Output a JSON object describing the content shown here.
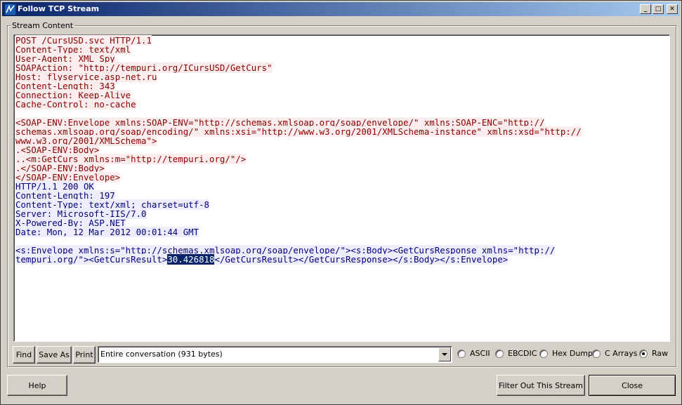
{
  "window": {
    "title": "Follow TCP Stream",
    "minimize_glyph": "_",
    "maximize_glyph": "□",
    "close_glyph": "✕"
  },
  "group_label": "Stream Content",
  "stream": {
    "request_lines": [
      "POST /CursUSD.svc HTTP/1.1",
      "Content-Type: text/xml",
      "User-Agent: XML Spy",
      "SOAPAction: \"http://tempuri.org/ICursUSD/GetCurs\"",
      "Host: flyservice.asp-net.ru",
      "Content-Length: 343",
      "Connection: Keep-Alive",
      "Cache-Control: no-cache",
      "",
      "<SOAP-ENV:Envelope xmlns:SOAP-ENV=\"http://schemas.xmlsoap.org/soap/envelope/\" xmlns:SOAP-ENC=\"http://",
      "schemas.xmlsoap.org/soap/encoding/\" xmlns:xsi=\"http://www.w3.org/2001/XMLSchema-instance\" xmlns:xsd=\"http://",
      "www.w3.org/2001/XMLSchema\">",
      ".<SOAP-ENV:Body>",
      "..<m:GetCurs xmlns:m=\"http://tempuri.org/\"/>",
      ".</SOAP-ENV:Body>",
      "</SOAP-ENV:Envelope>"
    ],
    "response_lines": [
      "HTTP/1.1 200 OK",
      "Content-Length: 197",
      "Content-Type: text/xml; charset=utf-8",
      "Server: Microsoft-IIS/7.0",
      "X-Powered-By: ASP.NET",
      "Date: Mon, 12 Mar 2012 00:01:44 GMT",
      "",
      "<s:Envelope xmlns:s=\"http://schemas.xmlsoap.org/soap/envelope/\"><s:Body><GetCursResponse xmlns=\"http://"
    ],
    "last_line_before": "tempuri.org/\"><GetCursResult>",
    "selected_text": "30.426818",
    "last_line_after": "</GetCursResult></GetCursResponse></s:Body></s:Envelope>",
    "colors": {
      "request_text": "#8b0000",
      "request_bg": "#fbeded",
      "response_text": "#000080",
      "response_bg": "#ededfb",
      "selection_bg": "#0a246a"
    }
  },
  "controls": {
    "find_label": "Find",
    "save_as_label": "Save As",
    "print_label": "Print",
    "conversation_select": "Entire conversation (931 bytes)",
    "radios": [
      {
        "label": "ASCII",
        "selected": false
      },
      {
        "label": "EBCDIC",
        "selected": false
      },
      {
        "label": "Hex Dump",
        "selected": false
      },
      {
        "label": "C Arrays",
        "selected": false
      },
      {
        "label": "Raw",
        "selected": true
      }
    ]
  },
  "footer": {
    "help_label": "Help",
    "filter_out_label": "Filter Out This Stream",
    "close_label": "Close"
  }
}
